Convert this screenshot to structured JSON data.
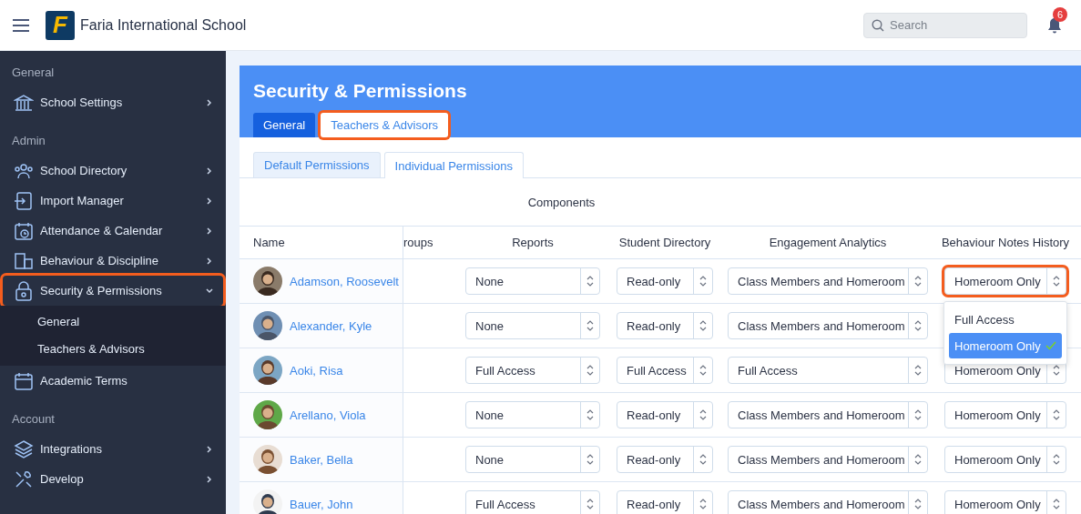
{
  "topbar": {
    "logo_letter": "F",
    "school_name": "Faria International School",
    "search": {
      "placeholder": "Search"
    },
    "notifications": "6"
  },
  "sidebar": {
    "sections": [
      {
        "label": "General",
        "items": [
          {
            "label": "School Settings",
            "expanded": false,
            "highlighted": false
          }
        ]
      },
      {
        "label": "Admin",
        "items": [
          {
            "label": "School Directory",
            "expanded": false,
            "highlighted": false
          },
          {
            "label": "Import Manager",
            "expanded": false,
            "highlighted": false
          },
          {
            "label": "Attendance & Calendar",
            "expanded": false,
            "highlighted": false
          },
          {
            "label": "Behaviour & Discipline",
            "expanded": false,
            "highlighted": false
          },
          {
            "label": "Security & Permissions",
            "expanded": true,
            "highlighted": true,
            "children": [
              {
                "label": "General"
              },
              {
                "label": "Teachers & Advisors"
              }
            ]
          },
          {
            "label": "Academic Terms",
            "highlighted": false
          }
        ]
      },
      {
        "label": "Account",
        "items": [
          {
            "label": "Integrations",
            "expanded": false,
            "highlighted": false
          },
          {
            "label": "Develop",
            "expanded": false,
            "highlighted": false
          }
        ]
      }
    ]
  },
  "page": {
    "title": "Security & Permissions",
    "tabs": [
      {
        "label": "General",
        "selected": true,
        "highlighted": false
      },
      {
        "label": "Teachers & Advisors",
        "selected": false,
        "highlighted": true
      }
    ],
    "subtabs": [
      {
        "label": "Default Permissions",
        "selected": false
      },
      {
        "label": "Individual Permissions",
        "selected": true
      }
    ]
  },
  "table": {
    "group_header": "Components",
    "columns": [
      {
        "label": "Name"
      },
      {
        "label": "roups"
      },
      {
        "label": "Reports"
      },
      {
        "label": "Student Directory"
      },
      {
        "label": "Engagement Analytics"
      },
      {
        "label": "Behaviour Notes History"
      }
    ],
    "rows": [
      {
        "cells": [
          {
            "value": "Adamson, Roosevelt"
          },
          null,
          {
            "value": "None"
          },
          {
            "value": "Read-only"
          },
          {
            "value": "Class Members and Homeroom"
          },
          {
            "value": "Homeroom Only",
            "highlighted": true,
            "open": true,
            "options": [
              {
                "label": "Full Access",
                "selected": false
              },
              {
                "label": "Homeroom Only",
                "selected": true
              }
            ]
          }
        ]
      },
      {
        "cells": [
          {
            "value": "Alexander, Kyle"
          },
          null,
          {
            "value": "None"
          },
          {
            "value": "Read-only"
          },
          {
            "value": "Class Members and Homeroom"
          }
        ]
      },
      {
        "cells": [
          {
            "value": "Aoki, Risa"
          },
          null,
          {
            "value": "Full Access"
          },
          {
            "value": "Full Access"
          },
          {
            "value": "Full Access"
          },
          {
            "value": "Homeroom Only"
          }
        ]
      },
      {
        "cells": [
          {
            "value": "Arellano, Viola"
          },
          null,
          {
            "value": "None"
          },
          {
            "value": "Read-only"
          },
          {
            "value": "Class Members and Homeroom"
          },
          {
            "value": "Homeroom Only"
          }
        ]
      },
      {
        "cells": [
          {
            "value": "Baker, Bella"
          },
          null,
          {
            "value": "None"
          },
          {
            "value": "Read-only"
          },
          {
            "value": "Class Members and Homeroom"
          },
          {
            "value": "Homeroom Only"
          }
        ]
      },
      {
        "cells": [
          {
            "value": "Bauer, John"
          },
          null,
          {
            "value": "Full Access"
          },
          {
            "value": "Read-only"
          },
          {
            "value": "Class Members and Homeroom"
          },
          {
            "value": "Homeroom Only"
          }
        ]
      }
    ]
  }
}
